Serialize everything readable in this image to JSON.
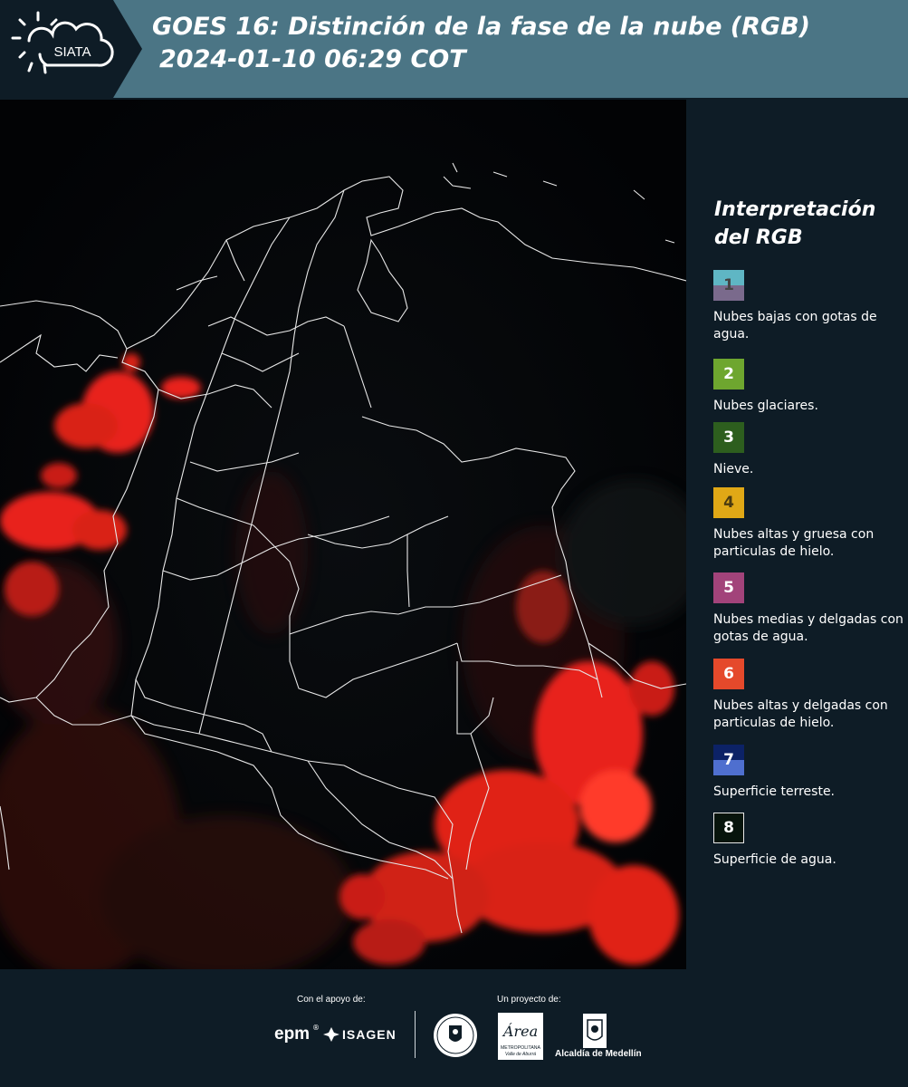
{
  "header": {
    "logo_text": "SIATA",
    "title_line1": "GOES 16: Distinción de la fase de la nube (RGB)",
    "title_line2": "2024-01-10 06:29 COT"
  },
  "legend": {
    "title_line1": "Interpretación",
    "title_line2": "del RGB",
    "items": [
      {
        "num": "1",
        "label": "Nubes bajas con gotas de agua.",
        "color_top": "#5fb6c4",
        "color_bottom": "#7a6a8c",
        "num_color": "#444"
      },
      {
        "num": "2",
        "label": "Nubes glaciares.",
        "color_top": "#6ea62f",
        "color_bottom": "#6ea62f",
        "num_color": "#fff"
      },
      {
        "num": "3",
        "label": "Nieve.",
        "color_top": "#2d5e1e",
        "color_bottom": "#2d5e1e",
        "num_color": "#fff"
      },
      {
        "num": "4",
        "label": "Nubes altas y gruesa con particulas de hielo.",
        "color_top": "#e0a816",
        "color_bottom": "#e0a816",
        "num_color": "#4a3a10"
      },
      {
        "num": "5",
        "label": "Nubes medias y delgadas con gotas de agua.",
        "color_top": "#a2437a",
        "color_bottom": "#a2437a",
        "num_color": "#fff"
      },
      {
        "num": "6",
        "label": "Nubes altas y delgadas con particulas de hielo.",
        "color_top": "#e5492b",
        "color_bottom": "#e5492b",
        "num_color": "#fff"
      },
      {
        "num": "7",
        "label": "Superficie terreste.",
        "color_top": "#0c2266",
        "color_bottom": "#4f6fcf",
        "num_color": "#fff"
      },
      {
        "num": "8",
        "label": "Superficie de agua.",
        "color_top": "#07140c",
        "color_bottom": "#07140c",
        "num_color": "#fff"
      }
    ]
  },
  "footer": {
    "support_label": "Con el apoyo de:",
    "project_label": "Un proyecto de:",
    "epm": "epm",
    "isagen": "ISAGEN",
    "area_script": "Área",
    "area_sub1": "METROPOLITANA",
    "area_sub2": "Valle de Aburrá",
    "alcaldia": "Alcaldía de Medellín"
  },
  "colors": {
    "header_bg": "#4b7585",
    "logo_tab_bg": "#0e1c26",
    "panel_bg": "#0e1c26",
    "cloud_red": "#e8241c"
  }
}
